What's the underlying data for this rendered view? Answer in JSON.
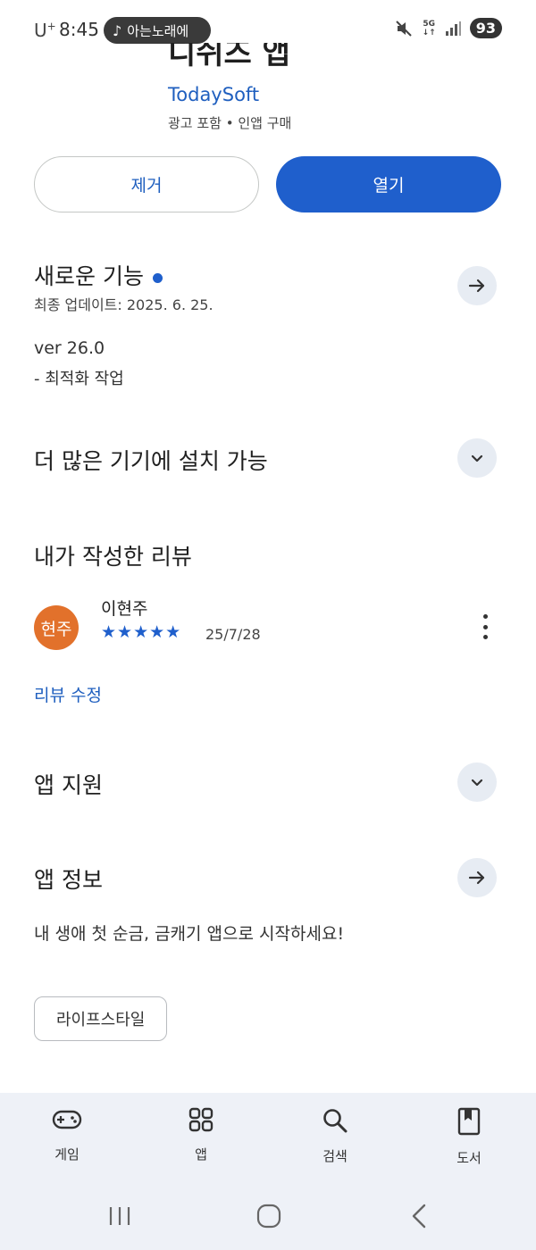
{
  "status_bar": {
    "carrier": "U",
    "carrier_sup": "+",
    "time": "8:45",
    "music_label": "아는노래에",
    "network": "5G",
    "battery": "93"
  },
  "app": {
    "title_partial": "디쉬즈 앱",
    "developer": "TodaySoft",
    "meta": "광고 포함 • 인앱 구매"
  },
  "actions": {
    "remove_label": "제거",
    "open_label": "열기"
  },
  "whats_new": {
    "title": "새로운 기능",
    "updated": "최종 업데이트: 2025. 6. 25.",
    "version": "ver 26.0",
    "notes": "- 최적화 작업"
  },
  "more_devices": {
    "title": "더 많은 기기에 설치 가능"
  },
  "my_review": {
    "title": "내가 작성한 리뷰",
    "avatar_text": "현주",
    "reviewer_name": "이현주",
    "stars": "★★★★★",
    "rating": 5,
    "date": "25/7/28",
    "edit_label": "리뷰 수정"
  },
  "app_support": {
    "title": "앱 지원"
  },
  "app_info": {
    "title": "앱 정보",
    "description": "내 생애 첫 순금, 금캐기 앱으로 시작하세요!",
    "category_chip": "라이프스타일"
  },
  "bottom_nav": {
    "items": [
      {
        "label": "게임",
        "icon": "gamepad-icon"
      },
      {
        "label": "앱",
        "icon": "apps-grid-icon"
      },
      {
        "label": "검색",
        "icon": "search-icon"
      },
      {
        "label": "도서",
        "icon": "book-icon"
      }
    ]
  },
  "colors": {
    "accent": "#1f5fcc",
    "link": "#1f5fbf",
    "avatar": "#e2712b",
    "nav_bg": "#eef1f7"
  }
}
